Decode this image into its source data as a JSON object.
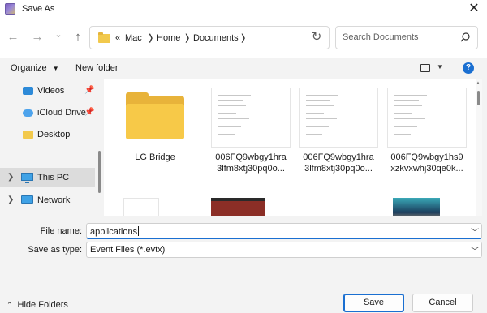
{
  "window": {
    "title": "Save As",
    "close_glyph": "✕"
  },
  "nav": {
    "back_glyph": "←",
    "forward_glyph": "→",
    "recent_glyph": "⌄",
    "up_glyph": "↑",
    "overflow_glyph": "«",
    "breadcrumb": [
      "Mac",
      "Home",
      "Documents"
    ],
    "separator_glyph": "❭",
    "refresh_glyph": "↻"
  },
  "search": {
    "placeholder": "Search Documents"
  },
  "toolbar": {
    "organize_label": "Organize",
    "organize_chevron": "▼",
    "new_folder_label": "New folder",
    "view_chevron": "▼",
    "help_glyph": "?"
  },
  "sidebar": {
    "items": [
      {
        "label": "Videos",
        "pinned": true
      },
      {
        "label": "iCloud Drive",
        "pinned": true
      },
      {
        "label": "Desktop",
        "pinned": false
      },
      {
        "label": "This PC",
        "selected": true,
        "expandable": true
      },
      {
        "label": "Network",
        "expandable": true
      }
    ],
    "pin_glyph": "📌",
    "expand_glyph": "❯"
  },
  "files": [
    {
      "name_line1": "LG Bridge",
      "name_line2": "",
      "type": "folder"
    },
    {
      "name_line1": "006FQ9wbgy1hra",
      "name_line2": "3lfm8xtj30pq0o...",
      "type": "document"
    },
    {
      "name_line1": "006FQ9wbgy1hra",
      "name_line2": "3lfm8xtj30pq0o...",
      "type": "document"
    },
    {
      "name_line1": "006FQ9wbgy1hs9",
      "name_line2": "xzkvxwhj30qe0k...",
      "type": "document"
    }
  ],
  "form": {
    "file_name_label": "File name:",
    "file_name_value": "applications",
    "save_type_label": "Save as type:",
    "save_type_value": "Event Files (*.evtx)",
    "dropdown_glyph": "﹀"
  },
  "footer": {
    "hide_folders_chevron": "⌃",
    "hide_folders_label": "Hide Folders",
    "save_label": "Save",
    "cancel_label": "Cancel"
  },
  "colors": {
    "accent": "#1a6fd1",
    "folder": "#f7c948",
    "selected_row": "#dcdcdc"
  }
}
